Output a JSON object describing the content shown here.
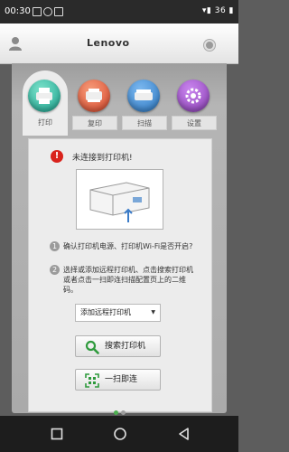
{
  "status_bar": {
    "time": "00:30",
    "right_text": "▾▮ 36 ▮"
  },
  "header": {
    "brand": "Lenovo"
  },
  "tabs": [
    {
      "label": "打印",
      "color": "#1aa590",
      "active": true
    },
    {
      "label": "复印",
      "color": "#d8472b",
      "active": false
    },
    {
      "label": "扫描",
      "color": "#2c78c3",
      "active": false
    },
    {
      "label": "设置",
      "color": "#8a3fb4",
      "active": false
    }
  ],
  "alert": {
    "message": "未连接到打印机!"
  },
  "steps": [
    {
      "num": "1",
      "text": "确认打印机电源、打印机Wi-Fi是否开启?"
    },
    {
      "num": "2",
      "text": "选择或添加远程打印机、点击搜索打印机或者点击一扫即连扫描配置页上的二维码。"
    }
  ],
  "remote_select": {
    "value": "添加远程打印机"
  },
  "buttons": {
    "search_label": "搜索打印机",
    "scan_label": "一扫即连"
  },
  "colors": {
    "accent_green": "#2e9a3c",
    "dot_active": "#4caf50",
    "dot_inactive": "#9e9e9e"
  }
}
